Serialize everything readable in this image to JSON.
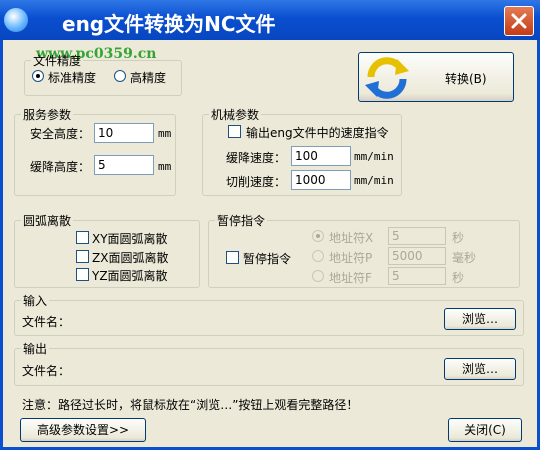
{
  "window": {
    "title": "eng文件转换为NC文件",
    "watermark": "www.pc0359.cn"
  },
  "precision": {
    "legend": "文件精度",
    "options": [
      "标准精度",
      "高精度"
    ],
    "selected": "标准精度"
  },
  "convert_button": {
    "label": "转换(B)",
    "icon": "refresh-arrows-icon"
  },
  "service": {
    "legend": "服务参数",
    "safe_height": {
      "label": "安全高度：",
      "value": "10",
      "unit": "mm"
    },
    "slow_height": {
      "label": "缓降高度：",
      "value": "5",
      "unit": "mm"
    }
  },
  "machine": {
    "legend": "机械参数",
    "output_speed": {
      "label": "输出eng文件中的速度指令",
      "checked": false
    },
    "slow_speed": {
      "label": "缓降速度：",
      "value": "100",
      "unit": "mm/min"
    },
    "cut_speed": {
      "label": "切削速度：",
      "value": "1000",
      "unit": "mm/min"
    }
  },
  "arc": {
    "legend": "圆弧离散",
    "items": [
      "XY面圆弧离散",
      "ZX面圆弧离散",
      "YZ面圆弧离散"
    ]
  },
  "pause": {
    "legend": "暂停指令",
    "checkbox_label": "暂停指令",
    "rows": [
      {
        "label": "地址符X",
        "value": "5",
        "unit": "秒",
        "checked": true
      },
      {
        "label": "地址符P",
        "value": "5000",
        "unit": "毫秒",
        "checked": false
      },
      {
        "label": "地址符F",
        "value": "5",
        "unit": "秒",
        "checked": false
      }
    ]
  },
  "input": {
    "legend": "输入",
    "file_label": "文件名：",
    "browse_label": "浏览…"
  },
  "output": {
    "legend": "输出",
    "file_label": "文件名：",
    "browse_label": "浏览…"
  },
  "note": "注意：路径过长时，将鼠标放在“浏览…”按钮上观看完整路径！",
  "advanced_button": "高级参数设置>>",
  "close_button": "关闭(C)",
  "colors": {
    "titlebar": "#0a4fd0",
    "dialog_bg": "#ece9d8",
    "close": "#c33c17"
  }
}
